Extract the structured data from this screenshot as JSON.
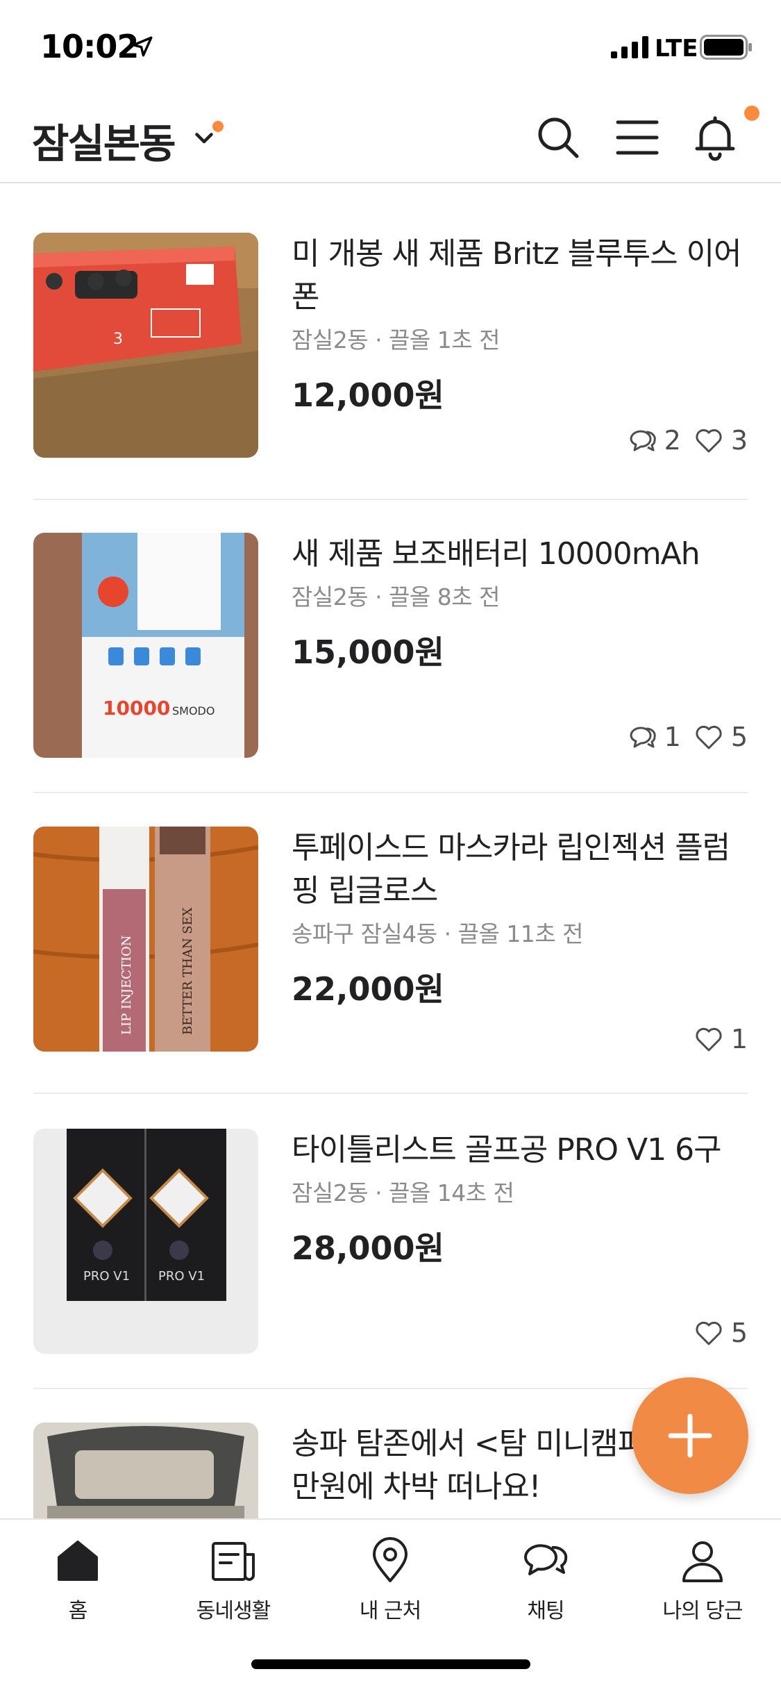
{
  "status_bar": {
    "time": "10:02",
    "network": "LTE"
  },
  "header": {
    "location": "잠실본동"
  },
  "items": [
    {
      "title": "미 개봉 새 제품 Britz 블루투스 이어폰",
      "meta": "잠실2동 · 끌올 1초 전",
      "price": "12,000원",
      "comments": "2",
      "likes": "3"
    },
    {
      "title": "새 제품 보조배터리 10000mAh",
      "meta": "잠실2동 · 끌올 8초 전",
      "price": "15,000원",
      "comments": "1",
      "likes": "5"
    },
    {
      "title": "투페이스드 마스카라 립인젝션 플럼핑 립글로스",
      "meta": "송파구 잠실4동 · 끌올 11초 전",
      "price": "22,000원",
      "likes": "1"
    },
    {
      "title": "타이틀리스트 골프공 PRO V1 6구",
      "meta": "잠실2동 · 끌올 14초 전",
      "price": "28,000원",
      "likes": "5"
    },
    {
      "title": "송파 탐존에서 <탐 미니캠퍼>로 5만원에 차박 떠나요!"
    }
  ],
  "nav": {
    "items": [
      {
        "label": "홈",
        "icon": "home-icon"
      },
      {
        "label": "동네생활",
        "icon": "community-icon"
      },
      {
        "label": "내 근처",
        "icon": "location-pin-icon"
      },
      {
        "label": "채팅",
        "icon": "chat-icon"
      },
      {
        "label": "나의 당근",
        "icon": "profile-icon"
      }
    ]
  },
  "colors": {
    "accent": "#ff8a3d",
    "fab": "#f08a44",
    "text": "#212124",
    "meta": "#8b8b8f"
  }
}
